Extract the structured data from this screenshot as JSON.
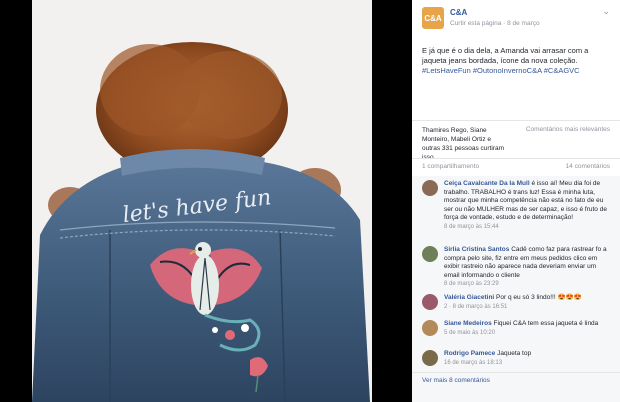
{
  "post": {
    "page_name": "C&A",
    "logo_text": "C&A",
    "like_label": "Curtir esta página",
    "date": "8 de março",
    "separator": " · ",
    "text": "E já que é o dia dela, a Amanda vai arrasar com a jaqueta jeans bordada, ícone da nova coleção.",
    "hashtags": "#LetsHaveFun #OutonoInvernoC&A #C&AGVC",
    "jacket_text": "let's have fun"
  },
  "reactions": {
    "names": "Thamires Rego, Siane Monteiro, Mabeli Ortiz e outras 331 pessoas curtiram isso.",
    "relevance": "Comentários mais relevantes",
    "shares": "1 compartilhamento",
    "comment_count": "14 comentários"
  },
  "comments": [
    {
      "name": "Ceiça Cavalcante Da Ia Mull",
      "text": "é isso aí! Meu dia foi de trabalho. TRABALHO é trans luz! Essa é minha luta, mostrar que minha competência não está no fato de eu ser ou não MULHER mas de ser capaz, e isso é fruto de força de vontade, estudo e de determinação!",
      "date": "8 de março às 15:44"
    },
    {
      "name": "Sirlia Cristina Santos",
      "text": "Cadê como faz para rastrear fo a compra pelo site, fiz entre em meus pedidos clico em exibir rastreio não aparece nada deveriam enviar um email informando o cliente",
      "date": "8 de março às 23:29"
    },
    {
      "name": "Valéria Giacetini",
      "text": "Por q eu só 3 lindo!!! 😍😍😍",
      "date": "2 · 8 de março às 16:51"
    },
    {
      "name": "Siane Medeiros",
      "text": "Fiquei C&A tem essa jaqueta é linda",
      "date": "5 de maio às 10:20"
    },
    {
      "name": "Rodrigo Pamece",
      "text": "Jaqueta top",
      "date": "16 de março às 18:13"
    }
  ],
  "view_more": "Ver mais 8 comentários",
  "colors": {
    "brand": "#e8a44a",
    "link": "#365899",
    "muted": "#90949c",
    "denim": "#3b5778"
  }
}
